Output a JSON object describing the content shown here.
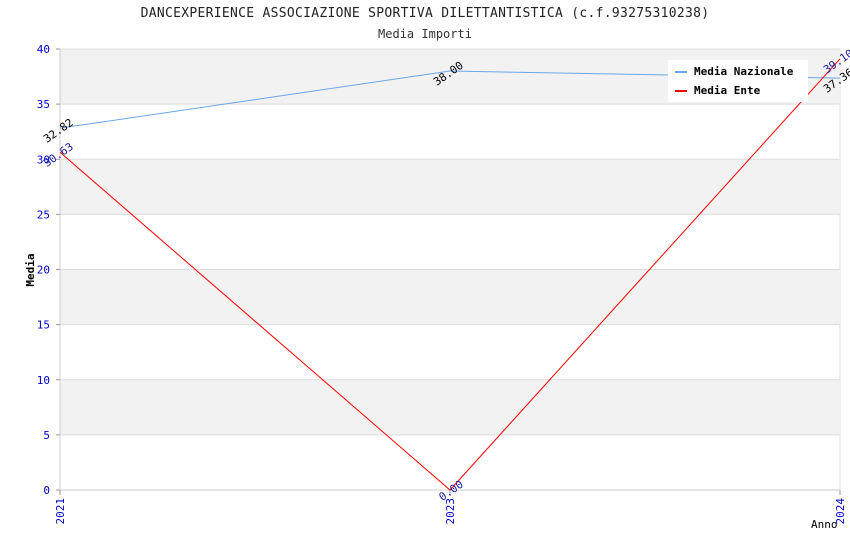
{
  "header": {
    "title": "DANCEXPERIENCE ASSOCIAZIONE SPORTIVA DILETTANTISTICA (c.f.93275310238)",
    "subtitle": "Media Importi"
  },
  "chart_data": {
    "type": "line",
    "title": "DANCEXPERIENCE ASSOCIAZIONE SPORTIVA DILETTANTISTICA (c.f.93275310238)",
    "subtitle": "Media Importi",
    "xlabel": "Anno",
    "ylabel": "Media",
    "categories": [
      "2021",
      "2023",
      "2024"
    ],
    "ylim": [
      0,
      40
    ],
    "yticks": [
      "0",
      "5",
      "10",
      "15",
      "20",
      "25",
      "30",
      "35",
      "40"
    ],
    "grid": "horizontal alternating bands",
    "legend": "top-right",
    "series": [
      {
        "name": "Media Nazionale",
        "color": "#6aa7e8",
        "label_color": "#000000",
        "values": [
          32.82,
          38.0,
          37.36
        ],
        "labels": [
          "32.82",
          "38.00",
          "37.36"
        ]
      },
      {
        "name": "Media Ente",
        "color": "#ff0000",
        "label_color": "#1a1aa0",
        "values": [
          30.63,
          0.0,
          39.1
        ],
        "labels": [
          "30.63",
          "0.00",
          "39.10"
        ]
      }
    ]
  },
  "colors": {
    "axis_text": "#0000cc",
    "band": "#f2f2f2",
    "grid": "#dddddd"
  }
}
